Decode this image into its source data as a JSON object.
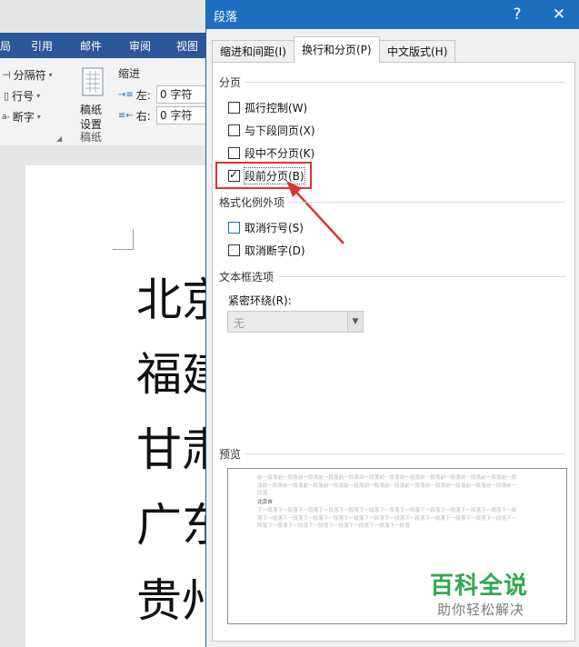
{
  "word": {
    "ribbon_tabs": [
      "局",
      "引用",
      "邮件",
      "审阅",
      "视图"
    ],
    "ribbon": {
      "separator_label": "分隔符",
      "line_numbers_label": "行号",
      "hyphenation_label": "断字",
      "manuscript_label_1": "稿纸",
      "manuscript_label_2": "设置",
      "manuscript_group": "稿纸",
      "indent_group": "缩进",
      "indent_left_label": "左:",
      "indent_left_value": "0 字符",
      "indent_right_label": "右:",
      "indent_right_value": "0 字符"
    },
    "document_lines": [
      "北京",
      "福建",
      "甘肃",
      "广东",
      "贵州"
    ]
  },
  "dialog": {
    "title": "段落",
    "help": "?",
    "close": "✕",
    "tabs": [
      "缩进和间距(I)",
      "换行和分页(P)",
      "中文版式(H)"
    ],
    "pagination": {
      "heading": "分页",
      "options": [
        {
          "label": "孤行控制(W)",
          "checked": false
        },
        {
          "label": "与下段同页(X)",
          "checked": false
        },
        {
          "label": "段中不分页(K)",
          "checked": false
        },
        {
          "label": "段前分页(B)",
          "checked": true
        }
      ]
    },
    "format_exceptions": {
      "heading": "格式化例外项",
      "options": [
        {
          "label": "取消行号(S)",
          "checked": false
        },
        {
          "label": "取消断字(D)",
          "checked": false
        }
      ]
    },
    "textbox": {
      "heading": "文本框选项",
      "wrap_label": "紧密环绕(R):",
      "wrap_value": "无"
    },
    "preview": {
      "heading": "预览",
      "before_text": "前一段落前一段落前一段落前一段落前一段落前一段落前一段落前一段落前一段落前一段落前一段落前一段落前一段落前一段落前一段落前一段落前一段落前一段落前一段落前一段落前一段落前一段落前一段落前一段落前一段落前一段落",
      "sample_text": "北京市",
      "after_text": "下一段落下一段落下一段落下一段落下一段落下一段落下一段落下一段落下一段落下一段落下一段落下一段落下一段落下一段落下一段落下一段落下一段落下一段落下一段落下一段落下一段落下一段落下一段落下一段落下一段落下一段落下一段落下一段落下一段落下一段落下一段落下一段落下一段落"
    }
  },
  "watermark": {
    "brand": "百科全说",
    "slogan": "助你轻松解决"
  }
}
